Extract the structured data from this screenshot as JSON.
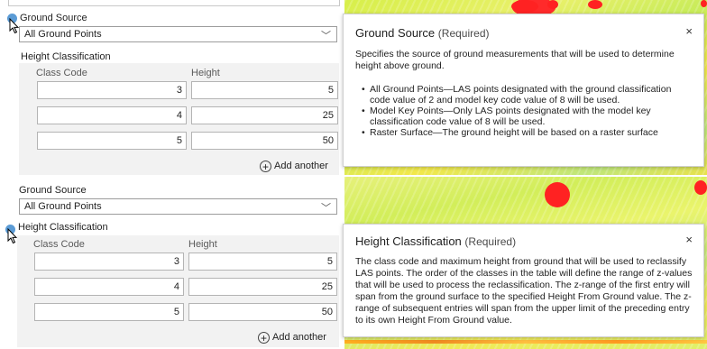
{
  "top": {
    "ground_source": {
      "label": "Ground Source",
      "value": "All Ground Points"
    },
    "height_classification": {
      "label": "Height Classification",
      "columns": [
        "Class Code",
        "Height"
      ],
      "rows": [
        [
          "3",
          "5"
        ],
        [
          "4",
          "25"
        ],
        [
          "5",
          "50"
        ]
      ],
      "add_label": "Add another"
    },
    "popup": {
      "title": "Ground Source",
      "required": "(Required)",
      "close": "×",
      "intro": "Specifies the source of ground measurements that will be used to determine height above ground.",
      "items": [
        "All Ground Points—LAS points designated with the ground classification code value of 2 and model key code value of 8 will be used.",
        "Model Key Points—Only LAS points designated with the model key classification code value of 8 will be used.",
        "Raster Surface—The ground height will be based on a raster surface"
      ]
    }
  },
  "bottom": {
    "ground_source": {
      "label": "Ground Source",
      "value": "All Ground Points"
    },
    "height_classification": {
      "label": "Height Classification",
      "columns": [
        "Class Code",
        "Height"
      ],
      "rows": [
        [
          "3",
          "5"
        ],
        [
          "4",
          "25"
        ],
        [
          "5",
          "50"
        ]
      ],
      "add_label": "Add another"
    },
    "popup": {
      "title": "Height Classification",
      "required": "(Required)",
      "close": "×",
      "body": "The class code and maximum height from ground that will be used to reclassify LAS points. The order of the classes in the table will define the range of z-values that will be used to process the reclassification. The z-range of the first entry will span from the ground surface to the specified Height From Ground value. The z-range of subsequent entries will span from the upper limit of the preceding entry to its own Height From Ground value."
    }
  },
  "colors": {
    "info_icon": "#5b9bd5",
    "map_red": "#ff2222"
  },
  "icons": {
    "info": "info-icon",
    "cursor": "mouse-cursor-icon",
    "dropdown": "chevron-down-icon",
    "add": "plus-circle-icon",
    "close": "close-icon"
  }
}
